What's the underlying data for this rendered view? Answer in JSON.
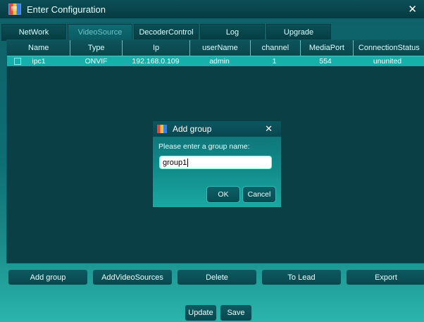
{
  "window": {
    "title": "Enter Configuration",
    "close_glyph": "✕"
  },
  "tabs": [
    "NetWork",
    "VideoSource",
    "DecoderControl",
    "Log",
    "Upgrade"
  ],
  "table": {
    "columns": [
      "Name",
      "Type",
      "Ip",
      "userName",
      "channel",
      "MediaPort",
      "ConnectionStatus"
    ],
    "rows": [
      [
        "ipc1",
        "ONVIF",
        "192.168.0.109",
        "admin",
        "1",
        "554",
        "ununited"
      ]
    ]
  },
  "dialog": {
    "title": "Add group",
    "close_glyph": "✕",
    "prompt": "Please enter a group name:",
    "input_value": "group1",
    "ok_label": "OK",
    "cancel_label": "Cancel"
  },
  "actions": [
    "Add group",
    "AddVideoSources",
    "Delete",
    "To Lead",
    "Export"
  ],
  "bottom": {
    "update_label": "Update",
    "save_label": "Save"
  },
  "colors": {
    "accent": "#16b0aa",
    "panel": "#0a3f45",
    "titlebar": "#073b43"
  }
}
